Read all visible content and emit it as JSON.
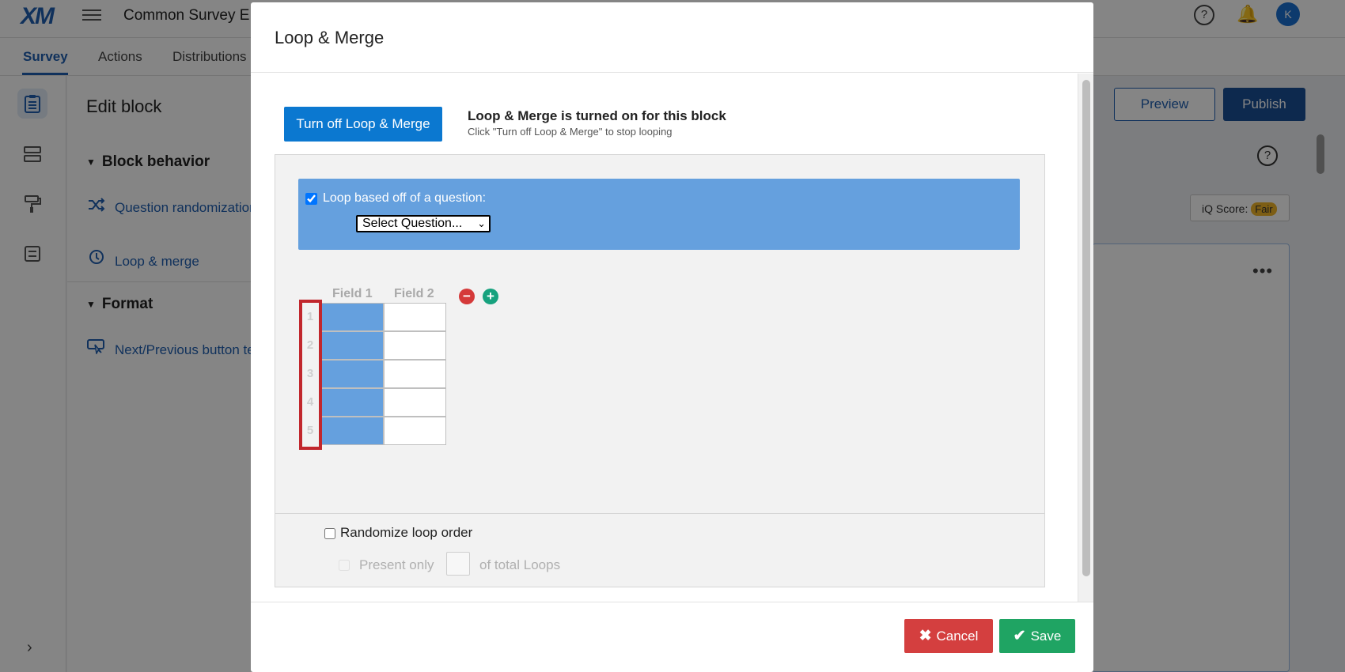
{
  "app": {
    "logo": "XM",
    "project_title": "Common Survey E",
    "user_initial": "K",
    "help_glyph": "?",
    "bell_glyph": "🔔"
  },
  "nav": {
    "tabs": [
      {
        "label": "Survey",
        "active": true
      },
      {
        "label": "Actions",
        "active": false
      },
      {
        "label": "Distributions",
        "active": false
      }
    ]
  },
  "left_rail": {
    "icons": [
      "survey-clipboard-icon",
      "flow-icon",
      "paint-roller-icon",
      "options-icon"
    ],
    "expand_glyph": "›"
  },
  "edit_panel": {
    "title": "Edit block",
    "sections": [
      {
        "title": "Block behavior",
        "items": [
          {
            "label": "Question randomization",
            "icon": "shuffle-icon"
          },
          {
            "label": "Loop & merge",
            "icon": "loop-icon"
          }
        ]
      },
      {
        "title": "Format",
        "items": [
          {
            "label": "Next/Previous button text",
            "icon": "cursor-pointer-icon"
          }
        ]
      }
    ]
  },
  "toolbar": {
    "preview_label": "Preview",
    "publish_label": "Publish",
    "iq_score_label": "iQ Score:",
    "iq_score_value": "Fair",
    "more_glyph": "•••"
  },
  "modal": {
    "title": "Loop & Merge",
    "turn_off_label": "Turn off Loop & Merge",
    "status_title": "Loop & Merge is turned on for this block",
    "status_subtitle": "Click \"Turn off Loop & Merge\" to stop looping",
    "loop_based_label": "Loop based off of a question:",
    "loop_based_checked": true,
    "select_question_value": "Select Question...",
    "select_chevron": "⌄",
    "field_headers": [
      "Field 1",
      "Field 2"
    ],
    "remove_field_glyph": "−",
    "add_field_glyph": "+",
    "rows": [
      "1",
      "2",
      "3",
      "4",
      "5"
    ],
    "randomize_label": "Randomize loop order",
    "present_only_label": "Present only",
    "of_total_label": "of total Loops",
    "cancel_label": "Cancel",
    "save_label": "Save",
    "cancel_glyph": "✖",
    "save_glyph": "✔"
  },
  "colors": {
    "primary_blue": "#0b78d0",
    "loop_panel_blue": "#65a0de",
    "highlight_red": "#c1272d",
    "cancel_red": "#d43f3f",
    "save_green": "#1fa463"
  }
}
